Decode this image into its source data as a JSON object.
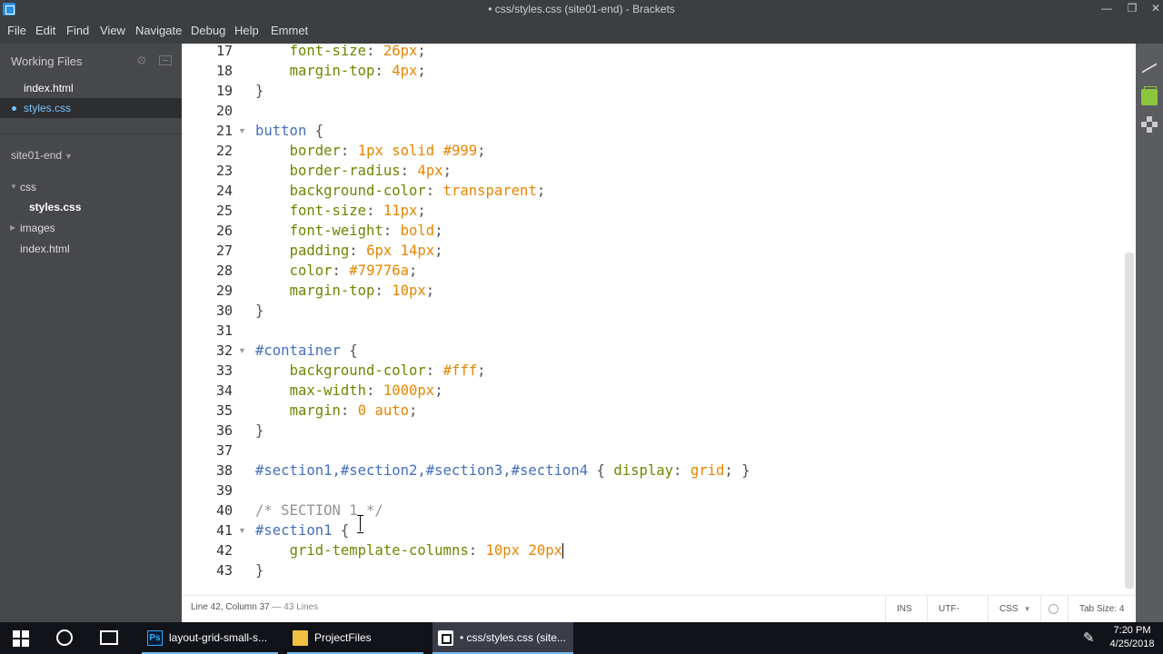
{
  "window": {
    "title": "• css/styles.css (site01-end) - Brackets"
  },
  "menu": [
    "File",
    "Edit",
    "Find",
    "View",
    "Navigate",
    "Debug",
    "Help",
    "Emmet"
  ],
  "sidebar": {
    "working_files_label": "Working Files",
    "working_files": [
      {
        "name": "index.html",
        "active": false
      },
      {
        "name": "styles.css",
        "active": true
      }
    ],
    "project_name": "site01-end",
    "tree": [
      {
        "name": "css",
        "type": "folder",
        "open": true
      },
      {
        "name": "styles.css",
        "type": "file",
        "level": 1
      },
      {
        "name": "images",
        "type": "folder",
        "open": false
      },
      {
        "name": "index.html",
        "type": "file",
        "level": 0
      }
    ]
  },
  "editor": {
    "lines": [
      {
        "n": "17",
        "tokens": [
          [
            "p",
            "    "
          ],
          [
            "prop",
            "font-size"
          ],
          [
            "p",
            ": "
          ],
          [
            "val",
            "26px"
          ],
          [
            "p",
            ";"
          ]
        ]
      },
      {
        "n": "18",
        "tokens": [
          [
            "p",
            "    "
          ],
          [
            "prop",
            "margin-top"
          ],
          [
            "p",
            ": "
          ],
          [
            "val",
            "4px"
          ],
          [
            "p",
            ";"
          ]
        ]
      },
      {
        "n": "19",
        "tokens": [
          [
            "p",
            "}"
          ]
        ]
      },
      {
        "n": "20",
        "tokens": []
      },
      {
        "n": "21",
        "fold": true,
        "tokens": [
          [
            "sel",
            "button"
          ],
          [
            "p",
            " {"
          ]
        ]
      },
      {
        "n": "22",
        "tokens": [
          [
            "p",
            "    "
          ],
          [
            "prop",
            "border"
          ],
          [
            "p",
            ": "
          ],
          [
            "val",
            "1px solid #999"
          ],
          [
            "p",
            ";"
          ]
        ]
      },
      {
        "n": "23",
        "tokens": [
          [
            "p",
            "    "
          ],
          [
            "prop",
            "border-radius"
          ],
          [
            "p",
            ": "
          ],
          [
            "val",
            "4px"
          ],
          [
            "p",
            ";"
          ]
        ]
      },
      {
        "n": "24",
        "tokens": [
          [
            "p",
            "    "
          ],
          [
            "prop",
            "background-color"
          ],
          [
            "p",
            ": "
          ],
          [
            "val",
            "transparent"
          ],
          [
            "p",
            ";"
          ]
        ]
      },
      {
        "n": "25",
        "tokens": [
          [
            "p",
            "    "
          ],
          [
            "prop",
            "font-size"
          ],
          [
            "p",
            ": "
          ],
          [
            "val",
            "11px"
          ],
          [
            "p",
            ";"
          ]
        ]
      },
      {
        "n": "26",
        "tokens": [
          [
            "p",
            "    "
          ],
          [
            "prop",
            "font-weight"
          ],
          [
            "p",
            ": "
          ],
          [
            "val",
            "bold"
          ],
          [
            "p",
            ";"
          ]
        ]
      },
      {
        "n": "27",
        "tokens": [
          [
            "p",
            "    "
          ],
          [
            "prop",
            "padding"
          ],
          [
            "p",
            ": "
          ],
          [
            "val",
            "6px 14px"
          ],
          [
            "p",
            ";"
          ]
        ]
      },
      {
        "n": "28",
        "tokens": [
          [
            "p",
            "    "
          ],
          [
            "prop",
            "color"
          ],
          [
            "p",
            ": "
          ],
          [
            "val",
            "#79776a"
          ],
          [
            "p",
            ";"
          ]
        ]
      },
      {
        "n": "29",
        "tokens": [
          [
            "p",
            "    "
          ],
          [
            "prop",
            "margin-top"
          ],
          [
            "p",
            ": "
          ],
          [
            "val",
            "10px"
          ],
          [
            "p",
            ";"
          ]
        ]
      },
      {
        "n": "30",
        "tokens": [
          [
            "p",
            "}"
          ]
        ]
      },
      {
        "n": "31",
        "tokens": []
      },
      {
        "n": "32",
        "fold": true,
        "tokens": [
          [
            "sel",
            "#container"
          ],
          [
            "p",
            " {"
          ]
        ]
      },
      {
        "n": "33",
        "tokens": [
          [
            "p",
            "    "
          ],
          [
            "prop",
            "background-color"
          ],
          [
            "p",
            ": "
          ],
          [
            "val",
            "#fff"
          ],
          [
            "p",
            ";"
          ]
        ]
      },
      {
        "n": "34",
        "tokens": [
          [
            "p",
            "    "
          ],
          [
            "prop",
            "max-width"
          ],
          [
            "p",
            ": "
          ],
          [
            "val",
            "1000px"
          ],
          [
            "p",
            ";"
          ]
        ]
      },
      {
        "n": "35",
        "tokens": [
          [
            "p",
            "    "
          ],
          [
            "prop",
            "margin"
          ],
          [
            "p",
            ": "
          ],
          [
            "val",
            "0 auto"
          ],
          [
            "p",
            ";"
          ]
        ]
      },
      {
        "n": "36",
        "tokens": [
          [
            "p",
            "}"
          ]
        ]
      },
      {
        "n": "37",
        "tokens": []
      },
      {
        "n": "38",
        "tokens": [
          [
            "sel",
            "#section1,#section2,#section3,#section4"
          ],
          [
            "p",
            " { "
          ],
          [
            "prop",
            "display"
          ],
          [
            "p",
            ": "
          ],
          [
            "val",
            "grid"
          ],
          [
            "p",
            "; }"
          ]
        ]
      },
      {
        "n": "39",
        "tokens": []
      },
      {
        "n": "40",
        "tokens": [
          [
            "cm",
            "/* SECTION 1 */"
          ]
        ]
      },
      {
        "n": "41",
        "fold": true,
        "tokens": [
          [
            "sel",
            "#section1"
          ],
          [
            "p",
            " {"
          ]
        ]
      },
      {
        "n": "42",
        "cursor": true,
        "tokens": [
          [
            "p",
            "    "
          ],
          [
            "prop",
            "grid-template-columns"
          ],
          [
            "p",
            ": "
          ],
          [
            "val",
            "10px 20px"
          ]
        ]
      },
      {
        "n": "43",
        "tokens": [
          [
            "p",
            "}"
          ]
        ]
      }
    ]
  },
  "statusbar": {
    "position": "Line 42, Column 37",
    "separator": " — ",
    "lines": "43 Lines",
    "mode": "INS",
    "encoding": "UTF-8",
    "language": "CSS",
    "tab_size": "Tab Size: 4"
  },
  "taskbar": {
    "apps": [
      {
        "label": "layout-grid-small-s...",
        "icon": "photoshop-icon",
        "open": true,
        "active": false
      },
      {
        "label": "ProjectFiles",
        "icon": "folder-icon",
        "open": true,
        "active": false
      },
      {
        "label": "• css/styles.css (site...",
        "icon": "brackets-icon",
        "open": true,
        "active": true
      }
    ],
    "time": "7:20 PM",
    "date": "4/25/2018"
  }
}
